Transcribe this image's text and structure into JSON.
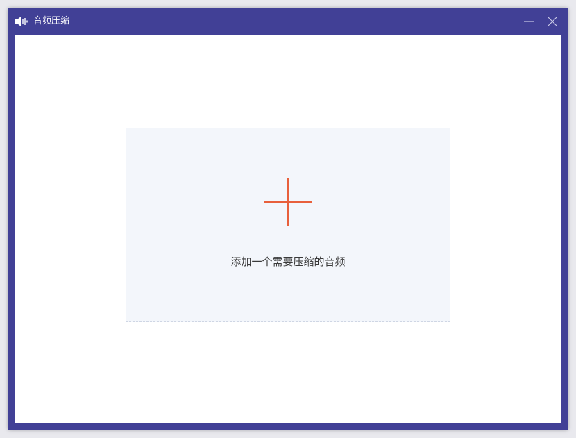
{
  "window": {
    "title": "音频压缩",
    "accent_color": "#414096",
    "app_icon": "speaker-icon",
    "controls": {
      "minimize_icon": "minimize-icon",
      "close_icon": "close-icon"
    }
  },
  "drop_zone": {
    "icon": "plus-icon",
    "icon_color": "#e8603c",
    "label": "添加一个需要压缩的音频"
  }
}
